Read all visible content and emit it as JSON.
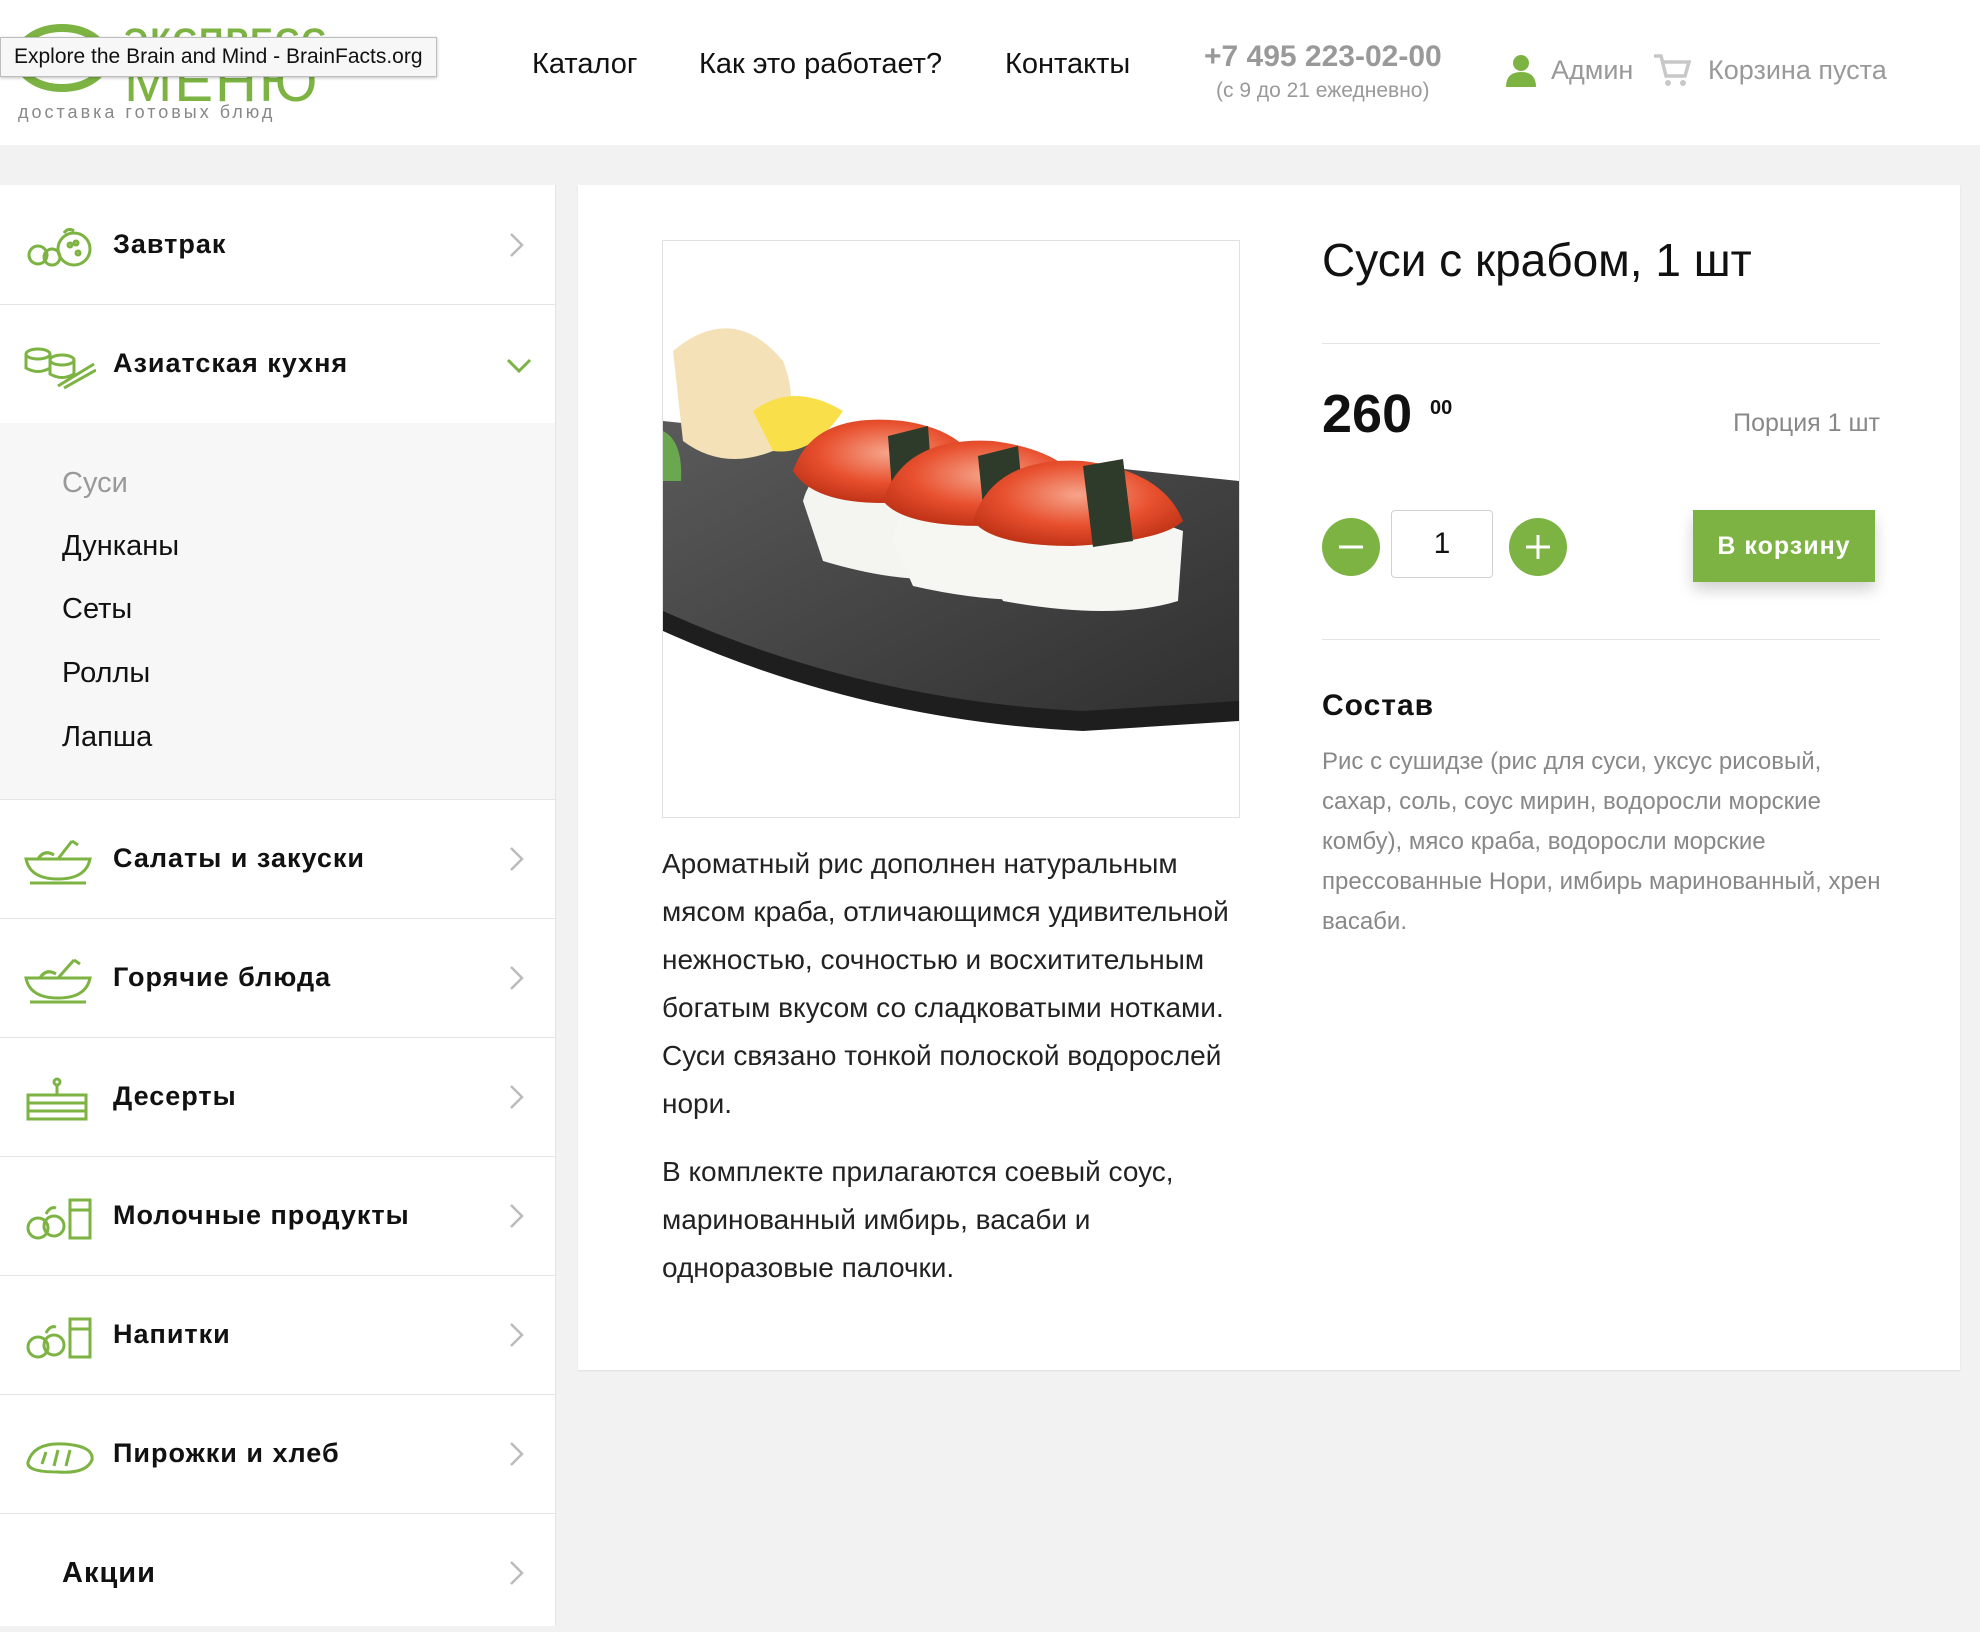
{
  "tooltip": "Explore the Brain and Mind - BrainFacts.org",
  "logo": {
    "top": "ЭКСПРЕСС",
    "main": "МЕНЮ",
    "sub": "доставка готовых блюд"
  },
  "nav": [
    "Каталог",
    "Как это работает?",
    "Контакты"
  ],
  "contact": {
    "phone": "+7 495 223-02-00",
    "hours": "(с 9 до 21 ежедневно)"
  },
  "user": {
    "label": "Админ",
    "icon": "user-icon"
  },
  "cart": {
    "label": "Корзина пуста",
    "icon": "cart-icon"
  },
  "sidebar": {
    "categories": [
      {
        "label": "Завтрак",
        "icon": "breakfast-icon"
      },
      {
        "label": "Азиатская кухня",
        "icon": "sushi-roll-icon",
        "expanded": true
      },
      {
        "label": "Салаты и закуски",
        "icon": "salad-bowl-icon"
      },
      {
        "label": "Горячие блюда",
        "icon": "hot-dish-icon"
      },
      {
        "label": "Десерты",
        "icon": "cake-icon"
      },
      {
        "label": "Молочные продукты",
        "icon": "dairy-icon"
      },
      {
        "label": "Напитки",
        "icon": "drinks-icon"
      },
      {
        "label": "Пирожки и хлеб",
        "icon": "bread-icon"
      },
      {
        "label": "Акции"
      }
    ],
    "subcategories": [
      "Суси",
      "Дунканы",
      "Сеты",
      "Роллы",
      "Лапша"
    ],
    "active_subcategory": "Суси"
  },
  "product": {
    "title": "Суси с крабом, 1 шт",
    "price": "260",
    "price_cents": "00",
    "portion": "Порция 1 шт",
    "quantity": "1",
    "add_to_cart": "В корзину",
    "description": [
      "Ароматный рис дополнен натуральным мясом краба, отличающимся удивительной нежностью, сочностью и восхитительным богатым вкусом со сладковатыми нотками. Суси связано тонкой полоской водорослей нори.",
      "В комплекте прилагаются соевый соус, маринованный имбирь, васаби и одноразовые палочки."
    ],
    "composition_title": "Состав",
    "composition": "Рис с сушидзе (рис для суси, уксус рисовый, сахар, соль, соус мирин, водоросли морские комбу), мясо краба, водоросли морские прессованные Нори, имбирь маринованный, хрен васаби."
  },
  "colors": {
    "accent": "#7cb342",
    "muted": "#999999",
    "background": "#f2f2f2"
  }
}
